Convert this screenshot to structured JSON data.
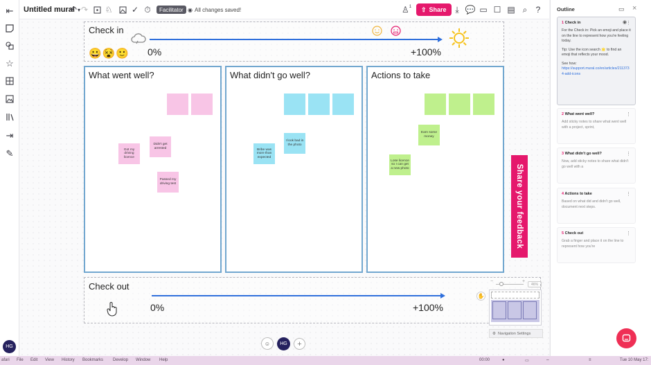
{
  "app": {
    "mural_title": "Untitled mural",
    "facilitator_label": "Facilitator",
    "saved_status": "All changes saved!",
    "share_label": "Share",
    "collaborator_count": "1",
    "brand_color": "#e5186c"
  },
  "checkin": {
    "title": "Check in",
    "start_label": "0%",
    "end_label": "+100%",
    "emojis": [
      "😀",
      "😵",
      "🙂"
    ]
  },
  "columns": [
    {
      "title": "What went well?",
      "stickies": [
        "Got my driving licence",
        "Didn't get arrested",
        "Passed my driving test"
      ]
    },
    {
      "title": "What didn't go well?",
      "stickies": [
        "Bribe was more than expected",
        "I look bad in the photo"
      ]
    },
    {
      "title": "Actions to take",
      "stickies": [
        "Earn some money",
        "Lose licence so I can get a new photo"
      ]
    }
  ],
  "feedback_banner": "Share your feedback",
  "checkout": {
    "title": "Check out",
    "start_label": "0%",
    "end_label": "+100%"
  },
  "navigation": {
    "settings_label": "Navigation Settings",
    "zoom_label": "46%"
  },
  "bottom": {
    "user_initials": "HG",
    "avatar_initials": "HG"
  },
  "outline": {
    "title": "Outline",
    "items": [
      {
        "num": "1",
        "title": "Check in",
        "body": "For the Check in: Pick an emoji and place it on the line to represent how you're feeling today.",
        "tip": "Tip: Use the icon search 🌟 to find an emoji that reflects your mood.",
        "see_how": "See how:",
        "link": "https://support.mural.co/en/articles/2113734-add-icons"
      },
      {
        "num": "2",
        "title": "What went well?",
        "body": "Add sticky notes to share what went well with a project, sprint,"
      },
      {
        "num": "3",
        "title": "What didn't go well?",
        "body": "Now, add sticky notes to share what didn't go well with a"
      },
      {
        "num": "4",
        "title": "Actions to take",
        "body": "Based on what did and didn't go well, document next steps."
      },
      {
        "num": "5",
        "title": "Check out",
        "body": "Grab a finger and place it on the line to represent how you're"
      }
    ]
  },
  "os_menu": [
    "afari",
    "File",
    "Edit",
    "View",
    "History",
    "Bookmarks",
    "Develop",
    "Window",
    "Help"
  ],
  "os_status": {
    "time_small": "00:00",
    "clock": "Tue 10 May 17:"
  }
}
